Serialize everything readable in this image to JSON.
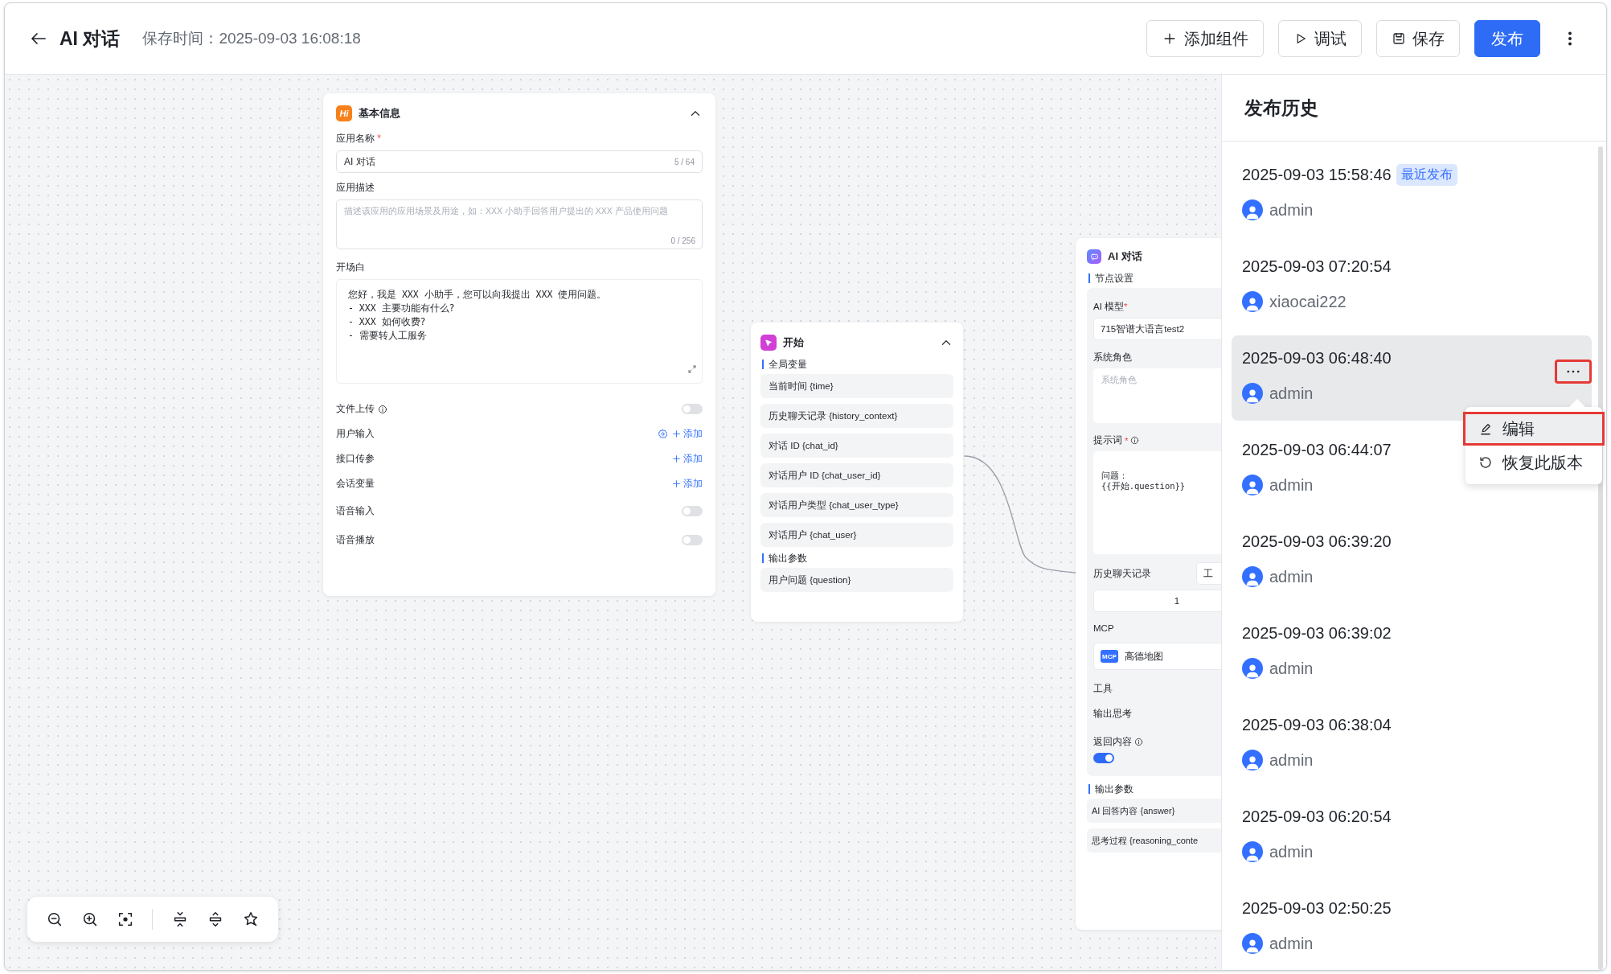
{
  "header": {
    "title": "AI 对话",
    "save_time": "保存时间：2025-09-03 16:08:18",
    "buttons": [
      {
        "label": "添加组件",
        "kind": "add"
      },
      {
        "label": "调试",
        "kind": "debug"
      },
      {
        "label": "保存",
        "kind": "save"
      },
      {
        "label": "发布",
        "kind": "publish"
      }
    ]
  },
  "basic_info": {
    "title": "基本信息",
    "badge": "Hi",
    "name_label": "应用名称",
    "required_mark": "*",
    "name_value": "AI 对话",
    "name_count": "5 / 64",
    "desc_label": "应用描述",
    "desc_placeholder": "描述该应用的应用场景及用途，如：XXX 小助手回答用户提出的 XXX 产品使用问题",
    "desc_count": "0 / 256",
    "opening_label": "开场白",
    "opening_text": "您好，我是 XXX 小助手，您可以向我提出 XXX 使用问题。\n- XXX 主要功能有什么?\n- XXX 如何收费?\n- 需要转人工服务",
    "settings": [
      {
        "label": "文件上传",
        "kind": "toggle",
        "info": true,
        "on": false
      },
      {
        "label": "用户输入",
        "kind": "add",
        "action": "添加",
        "gear": true
      },
      {
        "label": "接口传参",
        "kind": "add",
        "action": "添加",
        "gear": false
      },
      {
        "label": "会话变量",
        "kind": "add",
        "action": "添加",
        "gear": false
      },
      {
        "label": "语音输入",
        "kind": "toggle",
        "info": false,
        "on": false
      },
      {
        "label": "语音播放",
        "kind": "toggle",
        "info": false,
        "on": false
      }
    ]
  },
  "start_node": {
    "title": "开始",
    "sections": [
      {
        "title": "全局变量",
        "items": [
          "当前时间 {time}",
          "历史聊天记录 {history_context}",
          "对话 ID {chat_id}",
          "对话用户 ID {chat_user_id}",
          "对话用户类型 {chat_user_type}",
          "对话用户 {chat_user}"
        ]
      },
      {
        "title": "输出参数",
        "items": [
          "用户问题 {question}"
        ]
      }
    ]
  },
  "ai_node": {
    "title": "AI 对话",
    "section": "节点设置",
    "model_label": "AI 模型",
    "required_mark": "*",
    "model_value": "715智谱大语言test2",
    "role_label": "系统角色",
    "role_placeholder": "系统角色",
    "prompt_label": "提示词",
    "prompt_text": "问题：\n{{开始.question}}",
    "history_label": "历史聊天记录",
    "history_mode": "工",
    "history_count": "1",
    "mcp_label": "MCP",
    "mcp_badge": "MCP",
    "mcp_item": "高德地图",
    "tools_label": "工具",
    "think_label": "输出思考",
    "return_label": "返回内容",
    "return_on": true,
    "output_title": "输出参数",
    "outputs": [
      "AI 回答内容 {answer}",
      "思考过程 {reasoning_conte"
    ]
  },
  "history": {
    "title": "发布历史",
    "more_highlighted": true,
    "items": [
      {
        "time": "2025-09-03 15:58:46",
        "badge": "最近发布",
        "user": "admin",
        "selected": false
      },
      {
        "time": "2025-09-03 07:20:54",
        "user": "xiaocai222",
        "selected": false
      },
      {
        "time": "2025-09-03 06:48:40",
        "user": "admin",
        "selected": true
      },
      {
        "time": "2025-09-03 06:44:07",
        "user": "admin",
        "selected": false
      },
      {
        "time": "2025-09-03 06:39:20",
        "user": "admin",
        "selected": false
      },
      {
        "time": "2025-09-03 06:39:02",
        "user": "admin",
        "selected": false
      },
      {
        "time": "2025-09-03 06:38:04",
        "user": "admin",
        "selected": false
      },
      {
        "time": "2025-09-03 06:20:54",
        "user": "admin",
        "selected": false
      },
      {
        "time": "2025-09-03 02:50:25",
        "user": "admin",
        "selected": false
      }
    ],
    "menu": [
      {
        "label": "编辑",
        "kind": "edit",
        "highlighted": true
      },
      {
        "label": "恢复此版本",
        "kind": "restore",
        "highlighted": false
      }
    ]
  }
}
